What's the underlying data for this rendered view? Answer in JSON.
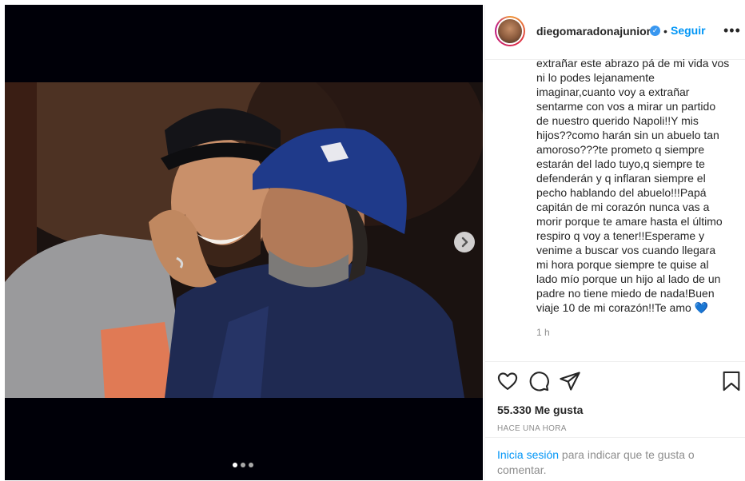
{
  "post": {
    "username": "diegomaradonajunior",
    "verified_badge": "✓",
    "separator": "•",
    "follow_label": "Seguir",
    "more_label": "•••",
    "caption": "extrañar este abrazo pá de mi vida vos\nni lo podes lejanamente\nimaginar,cuanto voy a extrañar\nsentarme con vos a mirar un partido\nde nuestro querido Napoli!!Y mis\nhijos??como harán sin un abuelo tan\namoroso???te prometo q siempre\nestarán del lado tuyo,q siempre te\ndefenderán y q inflaran siempre el\npecho hablando del abuelo!!!Papá\ncapitán de mi corazón nunca vas a\nmorir porque te amare hasta el último\nrespiro q voy a tener!!Esperame y\nvenime a buscar vos cuando llegara\nmi hora porque siempre te quise al\nlado mío porque un hijo al lado de un\npadre no tiene miedo de nada!Buen\nviaje 10 de mi corazón!!Te amo",
    "caption_emoji": "💙",
    "comment_time": "1 h",
    "likes": "55.330 Me gusta",
    "posted_ago": "HACE UNA HORA",
    "login_link": "Inicia sesión",
    "login_rest": " para indicar que te gusta o comentar."
  },
  "carousel": {
    "current_slide": 1,
    "total_slides": 3
  },
  "icons": {
    "like": "heart-icon",
    "comment": "comment-icon",
    "share": "send-icon",
    "save": "bookmark-icon",
    "next": "chevron-right-icon"
  },
  "colors": {
    "link": "#0095f6",
    "verified": "#3897f0",
    "text": "#262626",
    "muted": "#8e8e8e"
  }
}
